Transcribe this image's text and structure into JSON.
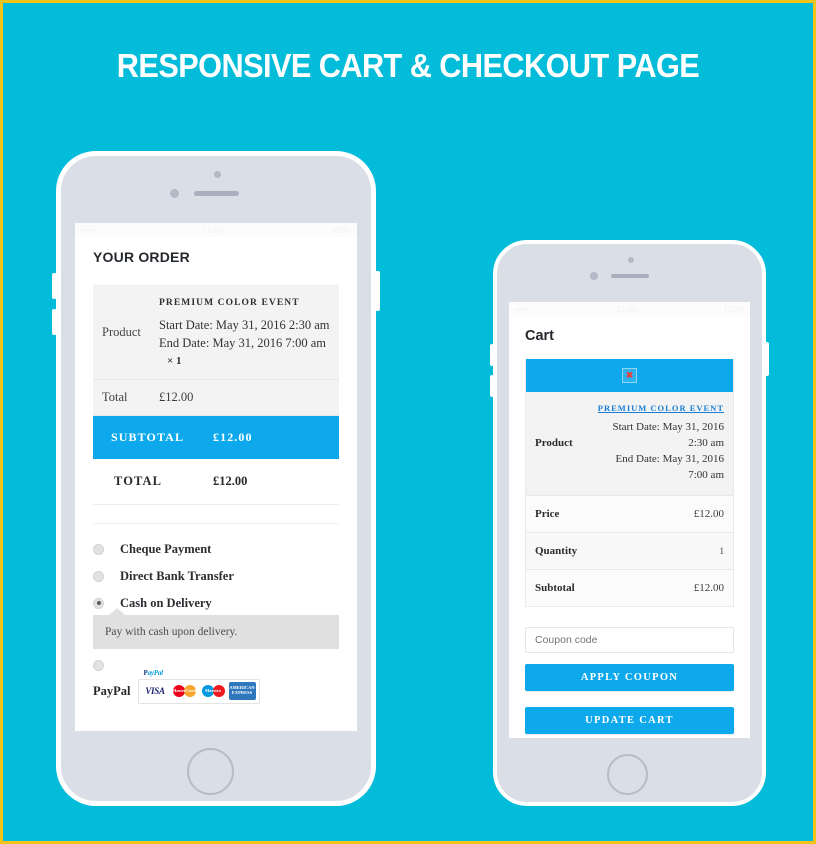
{
  "theme": {
    "background": "#03bcd9",
    "border": "#f0c419",
    "accent": "#0da9ec",
    "phone_body": "#dadee6"
  },
  "page": {
    "title": "RESPONSIVE CART & CHECKOUT PAGE"
  },
  "checkout_phone": {
    "statusbar": {
      "left": "•••••",
      "center": "21:00",
      "right": "100%"
    },
    "heading": "YOUR ORDER",
    "order_table": {
      "product_row": {
        "label": "Product",
        "name": "Premium Color Event",
        "start_date": "Start Date: May 31, 2016 2:30 am",
        "end_date": "End Date: May 31, 2016 7:00 am",
        "quantity": "× 1"
      },
      "total_row": {
        "label": "Total",
        "value": "£12.00"
      },
      "subtotal_row": {
        "label": "SUBTOTAL",
        "value": "£12.00"
      },
      "grand_total_row": {
        "label": "TOTAL",
        "value": "£12.00"
      }
    },
    "payment": {
      "options": [
        {
          "label": "Cheque Payment",
          "selected": false
        },
        {
          "label": "Direct Bank Transfer",
          "selected": false
        },
        {
          "label": "Cash on Delivery",
          "selected": true
        }
      ],
      "tooltip": "Pay with cash upon delivery.",
      "paypal_label": "PayPal",
      "paypal_logo": "PayPal",
      "cards": [
        "VISA",
        "MasterCard",
        "Maestro",
        "American Express"
      ]
    }
  },
  "cart_phone": {
    "statusbar": {
      "left": "•••••",
      "center": "21:00",
      "right": "100%"
    },
    "heading": "Cart",
    "product_image": "broken-image-icon",
    "table": {
      "product_row": {
        "label": "Product",
        "name": "Premium Color Event",
        "start_date": "Start Date: May 31, 2016 2:30 am",
        "end_date": "End Date: May 31, 2016 7:00 am"
      },
      "rows": [
        {
          "label": "Price",
          "value": "£12.00"
        },
        {
          "label": "Quantity",
          "value": "1"
        },
        {
          "label": "Subtotal",
          "value": "£12.00"
        }
      ]
    },
    "coupon": {
      "placeholder": "Coupon code",
      "value": "",
      "apply_label": "APPLY COUPON",
      "update_label": "UPDATE CART"
    }
  }
}
